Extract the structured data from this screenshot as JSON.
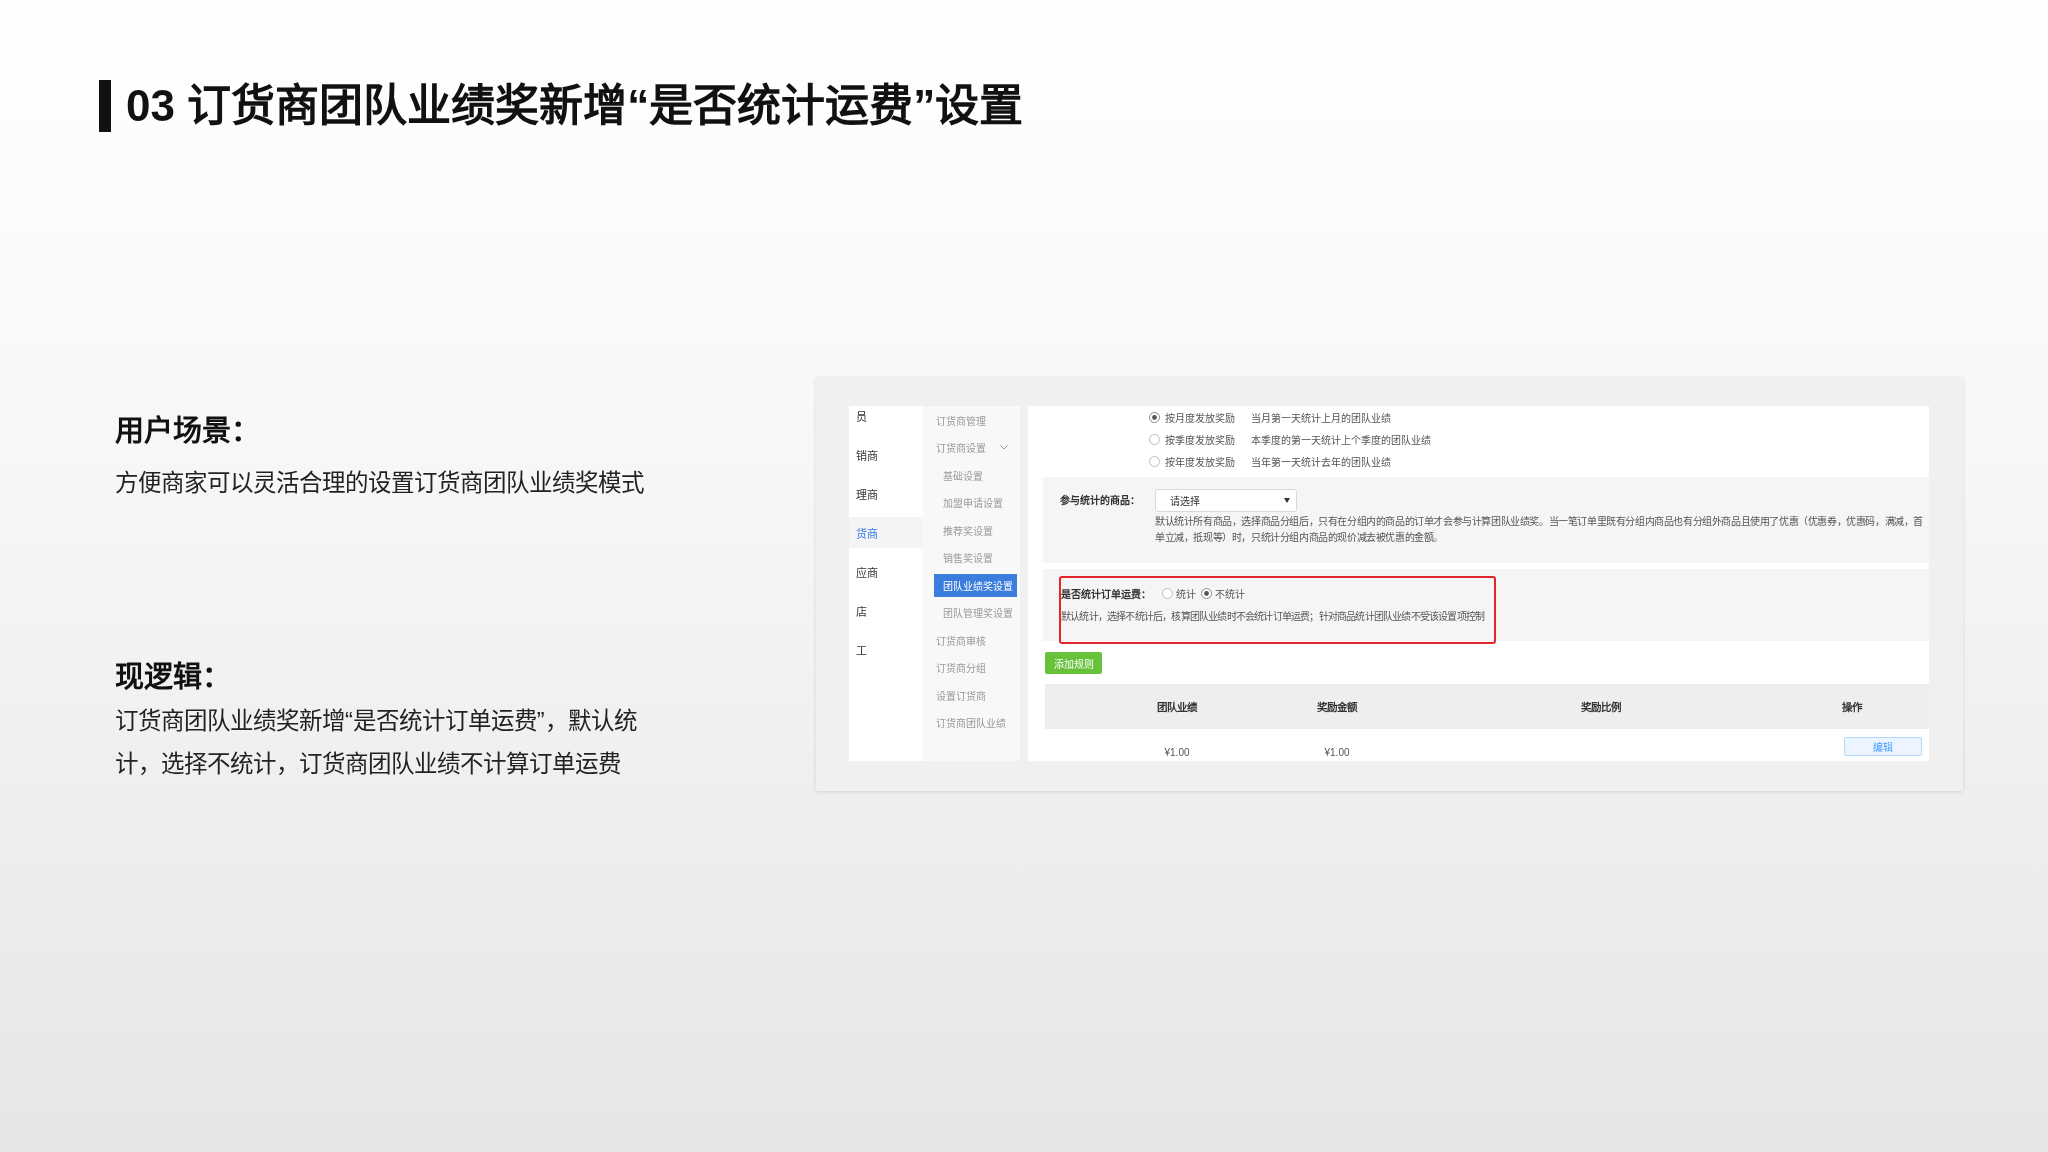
{
  "title": "03 订货商团队业绩奖新增“是否统计运费”设置",
  "sections": [
    {
      "heading": "用户场景：",
      "body": "方便商家可以灵活合理的设置订货商团队业绩奖模式"
    },
    {
      "heading": "现逻辑：",
      "body": "订货商团队业绩奖新增“是否统计订单运费”，默认统计，选择不统计，订货商团队业绩不计算订单运费"
    }
  ],
  "screenshot": {
    "nav_primary": [
      {
        "label": "员",
        "selected": false
      },
      {
        "label": "销商",
        "selected": false
      },
      {
        "label": "理商",
        "selected": false
      },
      {
        "label": "货商",
        "selected": true
      },
      {
        "label": "应商",
        "selected": false
      },
      {
        "label": "店",
        "selected": false
      },
      {
        "label": "工",
        "selected": false
      }
    ],
    "nav_secondary": [
      {
        "label": "订货商管理",
        "selected": false
      },
      {
        "label": "订货商设置",
        "selected": false,
        "expanded": true,
        "children": [
          {
            "label": "基础设置",
            "selected": false
          },
          {
            "label": "加盟申请设置",
            "selected": false
          },
          {
            "label": "推荐奖设置",
            "selected": false
          },
          {
            "label": "销售奖设置",
            "selected": false
          },
          {
            "label": "团队业绩奖设置",
            "selected": true
          },
          {
            "label": "团队管理奖设置",
            "selected": false
          }
        ]
      },
      {
        "label": "订货商审核",
        "selected": false
      },
      {
        "label": "订货商分组",
        "selected": false
      },
      {
        "label": "设置订货商",
        "selected": false
      },
      {
        "label": "订货商团队业绩",
        "selected": false
      }
    ],
    "reward_modes": [
      {
        "label": "按月度发放奖励",
        "description": "当月第一天统计上月的团队业绩",
        "selected": true
      },
      {
        "label": "按季度发放奖励",
        "description": "本季度的第一天统计上个季度的团队业绩",
        "selected": false
      },
      {
        "label": "按年度发放奖励",
        "description": "当年第一天统计去年的团队业绩",
        "selected": false
      }
    ],
    "product_filter": {
      "label": "参与统计的商品：",
      "placeholder": "请选择",
      "hint": "默认统计所有商品，选择商品分组后，只有在分组内的商品的订单才会参与计算团队业绩奖。当一笔订单里既有分组内商品也有分组外商品且使用了优惠（优惠券，优惠码，满减，首单立减，抵现等）时，只统计分组内商品的现价减去被优惠的金额。"
    },
    "shipping_fee": {
      "label": "是否统计订单运费：",
      "highlighted": true,
      "options": [
        {
          "label": "统计",
          "selected": false
        },
        {
          "label": "不统计",
          "selected": true
        }
      ],
      "hint": "默认统计，选择不统计后，核算团队业绩时不会统计订单运费；针对商品统计团队业绩不受该设置项控制"
    },
    "add_button": "添加规则",
    "table": {
      "columns": [
        "团队业绩",
        "奖励金额",
        "奖励比例",
        "操作"
      ],
      "rows": [
        {
          "performance": "¥1.00",
          "amount": "¥1.00",
          "action": "编辑"
        }
      ]
    }
  }
}
